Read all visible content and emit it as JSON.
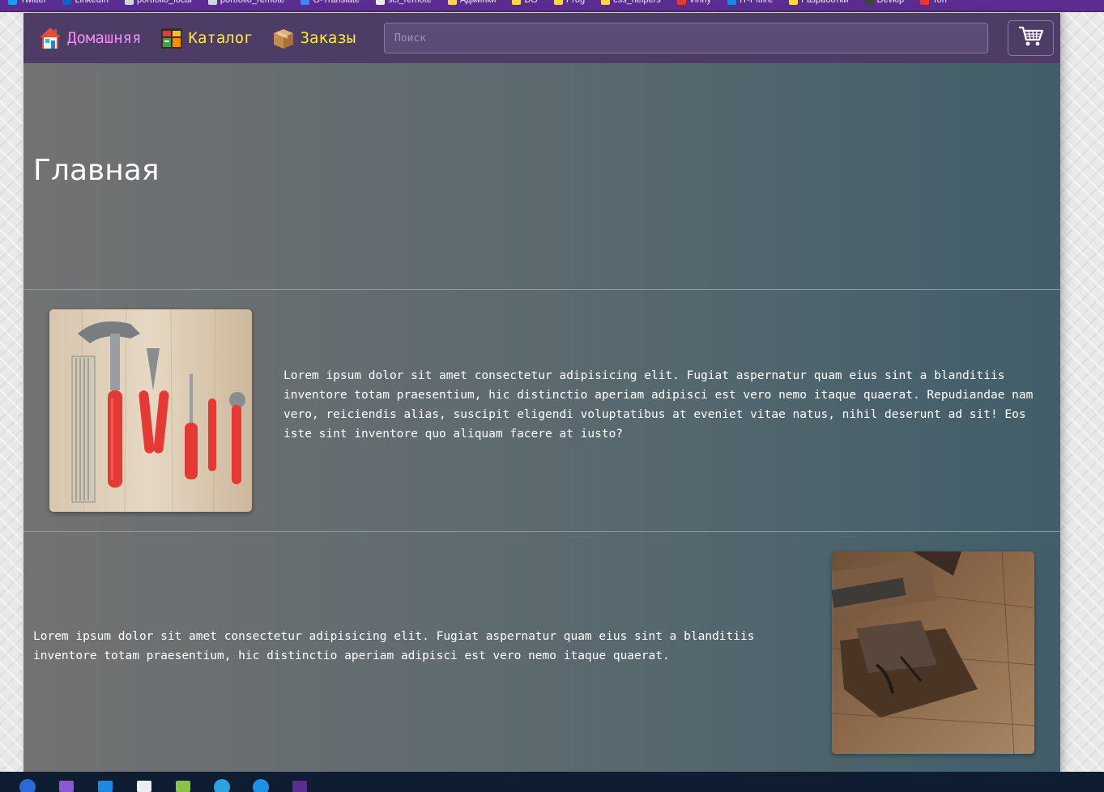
{
  "bookmarks": [
    {
      "label": "Twitter",
      "icon": "twitter-icon",
      "color": "#1d9bf0"
    },
    {
      "label": "LinkedIn",
      "icon": "linkedin-icon",
      "color": "#0a66c2"
    },
    {
      "label": "portfolio_local",
      "icon": "globe-icon",
      "color": "#cfd8dc"
    },
    {
      "label": "portfolio_remote",
      "icon": "globe-icon",
      "color": "#cfd8dc"
    },
    {
      "label": "G-Translate",
      "icon": "translate-icon",
      "color": "#4285f4"
    },
    {
      "label": "sci_remote",
      "icon": "page-icon",
      "color": "#eceff1"
    },
    {
      "label": "Админки",
      "icon": "folder-icon",
      "color": "#ffd54f"
    },
    {
      "label": "DO",
      "icon": "folder-icon",
      "color": "#ffd54f"
    },
    {
      "label": "Prog",
      "icon": "folder-icon",
      "color": "#ffd54f"
    },
    {
      "label": "css_helpers",
      "icon": "folder-icon",
      "color": "#ffd54f"
    },
    {
      "label": "Vinny",
      "icon": "opera-icon",
      "color": "#e53935"
    },
    {
      "label": "IT-Pitfire",
      "icon": "pen-icon",
      "color": "#1e88e5"
    },
    {
      "label": "Разработки",
      "icon": "folder-icon",
      "color": "#ffd54f"
    },
    {
      "label": "Devkip",
      "icon": "terminal-icon",
      "color": "#424242"
    },
    {
      "label": "Ton",
      "icon": "youtube-icon",
      "color": "#e53935"
    }
  ],
  "navbar": {
    "home_label": "Домашняя",
    "catalog_label": "Каталог",
    "orders_label": "Заказы",
    "search_placeholder": "Поиск",
    "home_icon": "house-icon",
    "catalog_icon": "store-icon",
    "orders_icon": "box-icon",
    "cart_icon": "shopping-cart-icon"
  },
  "hero": {
    "title": "Главная"
  },
  "features": [
    {
      "text": "Lorem ipsum dolor sit amet consectetur adipisicing elit. Fugiat aspernatur quam eius sint a blanditiis inventore totam praesentium, hic distinctio aperiam adipisci est vero nemo itaque quaerat. Repudiandae nam vero, reiciendis alias, suscipit eligendi voluptatibus at eveniet vitae natus, nihil deserunt ad sit! Eos iste sint inventore quo aliquam facere at iusto?",
      "image": "tools-photo"
    },
    {
      "text": "Lorem ipsum dolor sit amet consectetur adipisicing elit. Fugiat aspernatur quam eius sint a blanditiis inventore totam praesentium, hic distinctio aperiam adipisci est vero nemo itaque quaerat.",
      "image": "wood-plane-photo"
    }
  ],
  "taskbar": [
    {
      "icon": "thunderbird-icon"
    },
    {
      "icon": "visual-studio-icon"
    },
    {
      "icon": "vscode-icon"
    },
    {
      "icon": "notepad-icon"
    },
    {
      "icon": "notepad-plus-icon"
    },
    {
      "icon": "telegram-icon"
    },
    {
      "icon": "docker-icon"
    },
    {
      "icon": "terminal-icon"
    }
  ],
  "colors": {
    "navbar_bg": "#4c3c66",
    "home_link": "#f38bf3",
    "nav_link": "#ffe83a",
    "page_gradient_left": "#727272",
    "page_gradient_right": "#415e6a"
  }
}
